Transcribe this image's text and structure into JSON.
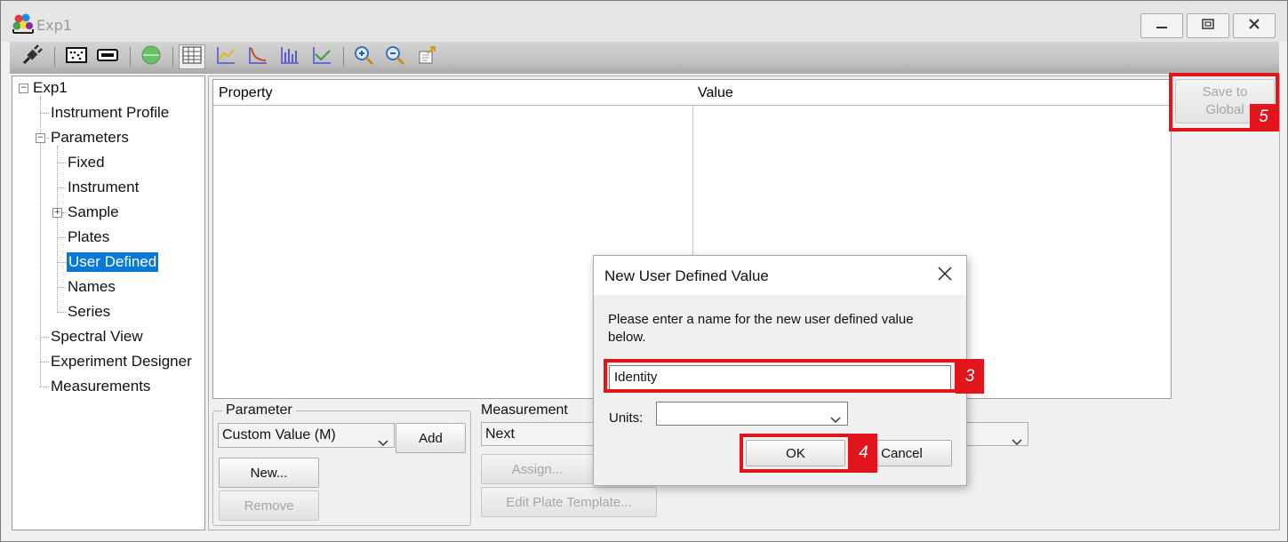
{
  "window": {
    "title": "Exp1",
    "minimize_icon": "minimize-icon",
    "maximize_icon": "maximize-icon",
    "close_icon": "close-icon"
  },
  "toolbar": {
    "icons": [
      "plug-icon",
      "plate-dots-icon",
      "plate-strip-icon",
      "green-circle-icon",
      "table-view-icon",
      "line-chart-icon",
      "curve-chart-icon",
      "bar-chart-icon",
      "scatter-chart-icon",
      "zoom-in-icon",
      "zoom-out-icon",
      "export-icon"
    ]
  },
  "tree": {
    "root": "Exp1",
    "items": [
      {
        "label": "Instrument Profile"
      },
      {
        "label": "Parameters"
      },
      {
        "label": "Fixed"
      },
      {
        "label": "Instrument"
      },
      {
        "label": "Sample"
      },
      {
        "label": "Plates"
      },
      {
        "label": "User Defined"
      },
      {
        "label": "Names"
      },
      {
        "label": "Series"
      },
      {
        "label": "Spectral View"
      },
      {
        "label": "Experiment Designer"
      },
      {
        "label": "Measurements"
      }
    ]
  },
  "grid": {
    "col_property": "Property",
    "col_value": "Value"
  },
  "save_to_global": {
    "label_line1": "Save to",
    "label_line2": "Global"
  },
  "parameter": {
    "group_label": "Parameter",
    "combo_value": "Custom Value (M)",
    "add_label": "Add",
    "new_label": "New...",
    "remove_label": "Remove"
  },
  "measurement": {
    "group_label": "Measurement",
    "combo_value": "Next",
    "assign_label": "Assign...",
    "edit_template_label": "Edit Plate Template..."
  },
  "dialog": {
    "title": "New User Defined Value",
    "message": "Please enter a name for the new user defined value below.",
    "name_value": "Identity",
    "units_label": "Units:",
    "units_value": "",
    "ok_label": "OK",
    "cancel_label": "Cancel"
  },
  "annotations": {
    "tag3": "3",
    "tag4": "4",
    "tag5": "5",
    "color": "#e2141c"
  }
}
